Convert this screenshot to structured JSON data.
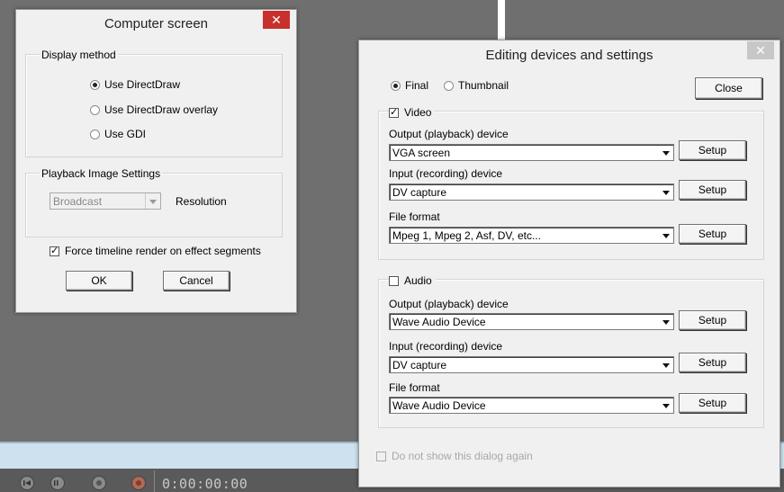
{
  "background": {
    "timecode": "0:00:00:00"
  },
  "computer_screen": {
    "title": "Computer screen",
    "close_glyph": "✕",
    "display_method": {
      "legend": "Display method",
      "options": [
        {
          "label": "Use DirectDraw",
          "selected": true
        },
        {
          "label": "Use DirectDraw overlay",
          "selected": false
        },
        {
          "label": "Use GDI",
          "selected": false
        }
      ]
    },
    "playback": {
      "legend": "Playback Image Settings",
      "combo_value": "Broadcast",
      "resolution_label": "Resolution"
    },
    "force_render": {
      "label": "Force timeline render on effect segments",
      "checked": true
    },
    "ok_label": "OK",
    "cancel_label": "Cancel"
  },
  "editing_devices": {
    "title": "Editing devices and settings",
    "close_glyph": "✕",
    "mode": {
      "final_label": "Final",
      "final_selected": true,
      "thumbnail_label": "Thumbnail",
      "thumbnail_selected": false
    },
    "close_label": "Close",
    "video": {
      "label": "Video",
      "checked": true,
      "output_label": "Output (playback) device",
      "output_value": "VGA screen",
      "input_label": "Input (recording) device",
      "input_value": "DV capture",
      "format_label": "File format",
      "format_value": "Mpeg 1, Mpeg 2, Asf, DV, etc...",
      "setup_label": "Setup"
    },
    "audio": {
      "label": "Audio",
      "checked": false,
      "output_label": "Output (playback) device",
      "output_value": "Wave Audio Device",
      "input_label": "Input (recording) device",
      "input_value": "DV capture",
      "format_label": "File format",
      "format_value": "Wave Audio Device",
      "setup_label": "Setup"
    },
    "dont_show_label": "Do not show this dialog again",
    "check_glyph": "✓"
  }
}
